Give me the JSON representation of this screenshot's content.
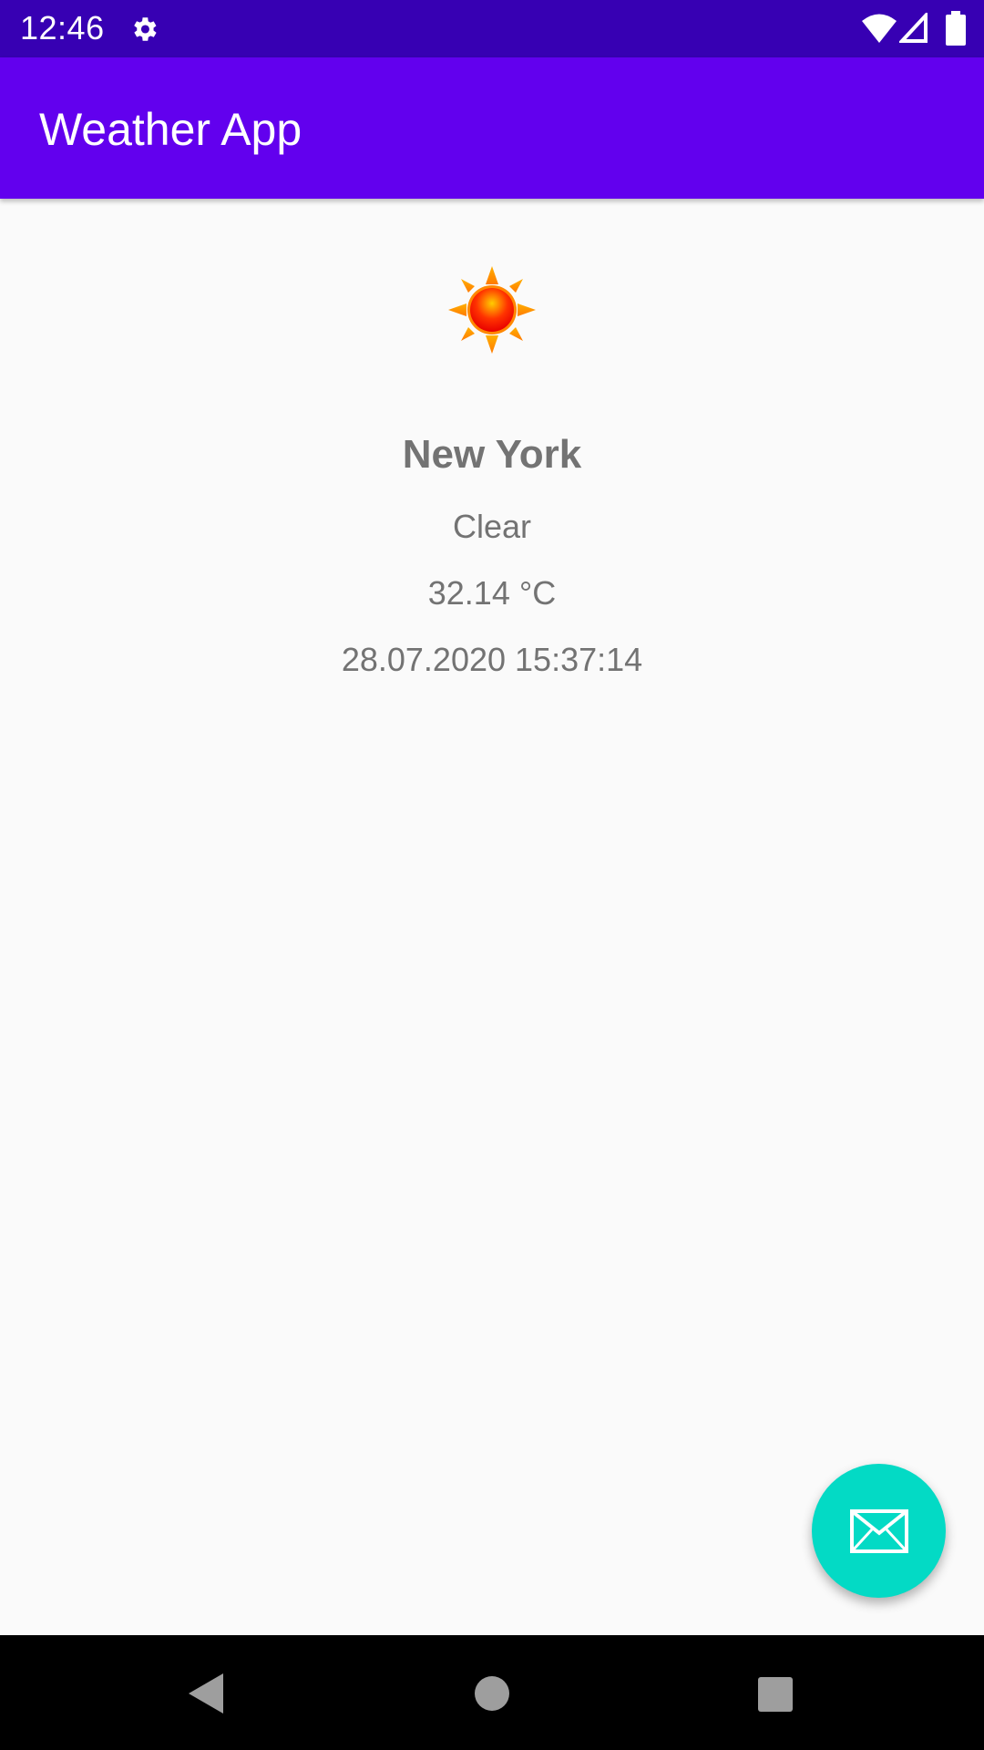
{
  "status_bar": {
    "time": "12:46",
    "background": "#3700b3",
    "icons": [
      "gear-icon",
      "wifi-icon",
      "cell-signal-icon",
      "battery-icon"
    ]
  },
  "app_bar": {
    "title": "Weather App",
    "background": "#6200ee"
  },
  "weather": {
    "icon": "sun-icon",
    "city": "New York",
    "condition": "Clear",
    "temperature": "32.14 °C",
    "updated": "28.07.2020 15:37:14"
  },
  "fab": {
    "icon": "mail-icon",
    "color": "#03dac5"
  },
  "nav_bar": {
    "icons": [
      "back-icon",
      "home-icon",
      "recents-icon"
    ]
  }
}
